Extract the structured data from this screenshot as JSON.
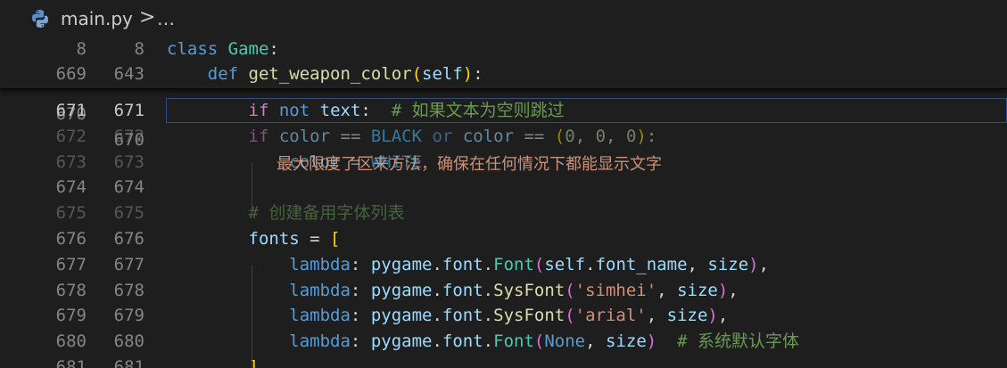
{
  "breadcrumb": {
    "file_name": "main.py",
    "chevron": ">",
    "ellipsis": "…",
    "file_icon": "python-icon"
  },
  "sticky": [
    {
      "ln_orig": "8",
      "ln_mod": "8",
      "tokens": [
        [
          "kw",
          "class"
        ],
        [
          "punc",
          " "
        ],
        [
          "cls",
          "Game"
        ],
        [
          "punc",
          ":"
        ]
      ]
    },
    {
      "ln_orig": "669",
      "ln_mod": "643",
      "tokens": [
        [
          "punc",
          "    "
        ],
        [
          "kw",
          "def"
        ],
        [
          "punc",
          " "
        ],
        [
          "fn",
          "get_weapon_color"
        ],
        [
          "brk1",
          "("
        ],
        [
          "var",
          "self"
        ],
        [
          "brk1",
          ")"
        ],
        [
          "punc",
          ":"
        ]
      ]
    }
  ],
  "behind_sticky": {
    "ln_orig": "668",
    "ln_mod": "670",
    "ln_orig_2": "670",
    "text": "最大限度了区来方法，确保在任何情况下都能显示文字"
  },
  "lines": [
    {
      "ln_orig": "671",
      "ln_mod": "671",
      "current": true,
      "dim": false,
      "tokens": [
        [
          "punc",
          "        "
        ],
        [
          "ctrl",
          "if"
        ],
        [
          "punc",
          " "
        ],
        [
          "kw",
          "not"
        ],
        [
          "punc",
          " "
        ],
        [
          "var",
          "text"
        ],
        [
          "punc",
          ":  "
        ],
        [
          "cmt",
          "# 如果文本为空则跳过"
        ]
      ]
    },
    {
      "ln_orig": "672",
      "ln_mod": "672",
      "current": false,
      "dim": true,
      "tokens": [
        [
          "punc",
          "        "
        ],
        [
          "ctrl",
          "if"
        ],
        [
          "punc",
          " "
        ],
        [
          "var",
          "color"
        ],
        [
          "punc",
          " == "
        ],
        [
          "const",
          "BLACK"
        ],
        [
          "punc",
          " "
        ],
        [
          "kw",
          "or"
        ],
        [
          "punc",
          " "
        ],
        [
          "var",
          "color"
        ],
        [
          "punc",
          " == "
        ],
        [
          "brk1",
          "("
        ],
        [
          "num",
          "0"
        ],
        [
          "punc",
          ", "
        ],
        [
          "num",
          "0"
        ],
        [
          "punc",
          ", "
        ],
        [
          "num",
          "0"
        ],
        [
          "brk1",
          ")"
        ],
        [
          "punc",
          ":"
        ]
      ]
    },
    {
      "ln_orig": "673",
      "ln_mod": "673",
      "current": false,
      "dim": true,
      "tokens": [
        [
          "punc",
          "            "
        ],
        [
          "var",
          "color"
        ],
        [
          "punc",
          " = "
        ],
        [
          "const",
          "WHITE"
        ]
      ]
    },
    {
      "ln_orig": "674",
      "ln_mod": "674",
      "current": false,
      "dim": false,
      "tokens": []
    },
    {
      "ln_orig": "675",
      "ln_mod": "675",
      "current": false,
      "dim": true,
      "tokens": [
        [
          "punc",
          "        "
        ],
        [
          "cmt",
          "# 创建备用字体列表"
        ]
      ]
    },
    {
      "ln_orig": "676",
      "ln_mod": "676",
      "current": false,
      "dim": false,
      "tokens": [
        [
          "punc",
          "        "
        ],
        [
          "var",
          "fonts"
        ],
        [
          "punc",
          " = "
        ],
        [
          "brk1",
          "["
        ]
      ]
    },
    {
      "ln_orig": "677",
      "ln_mod": "677",
      "current": false,
      "dim": false,
      "tokens": [
        [
          "punc",
          "            "
        ],
        [
          "kw",
          "lambda"
        ],
        [
          "punc",
          ": "
        ],
        [
          "var",
          "pygame"
        ],
        [
          "punc",
          "."
        ],
        [
          "var",
          "font"
        ],
        [
          "punc",
          "."
        ],
        [
          "cls",
          "Font"
        ],
        [
          "brk2",
          "("
        ],
        [
          "var",
          "self"
        ],
        [
          "punc",
          "."
        ],
        [
          "var",
          "font_name"
        ],
        [
          "punc",
          ", "
        ],
        [
          "var",
          "size"
        ],
        [
          "brk2",
          ")"
        ],
        [
          "punc",
          ","
        ]
      ]
    },
    {
      "ln_orig": "678",
      "ln_mod": "678",
      "current": false,
      "dim": false,
      "tokens": [
        [
          "punc",
          "            "
        ],
        [
          "kw",
          "lambda"
        ],
        [
          "punc",
          ": "
        ],
        [
          "var",
          "pygame"
        ],
        [
          "punc",
          "."
        ],
        [
          "var",
          "font"
        ],
        [
          "punc",
          "."
        ],
        [
          "fn",
          "SysFont"
        ],
        [
          "brk2",
          "("
        ],
        [
          "str",
          "'simhei'"
        ],
        [
          "punc",
          ", "
        ],
        [
          "var",
          "size"
        ],
        [
          "brk2",
          ")"
        ],
        [
          "punc",
          ","
        ]
      ]
    },
    {
      "ln_orig": "679",
      "ln_mod": "679",
      "current": false,
      "dim": false,
      "tokens": [
        [
          "punc",
          "            "
        ],
        [
          "kw",
          "lambda"
        ],
        [
          "punc",
          ": "
        ],
        [
          "var",
          "pygame"
        ],
        [
          "punc",
          "."
        ],
        [
          "var",
          "font"
        ],
        [
          "punc",
          "."
        ],
        [
          "fn",
          "SysFont"
        ],
        [
          "brk2",
          "("
        ],
        [
          "str",
          "'arial'"
        ],
        [
          "punc",
          ", "
        ],
        [
          "var",
          "size"
        ],
        [
          "brk2",
          ")"
        ],
        [
          "punc",
          ","
        ]
      ]
    },
    {
      "ln_orig": "680",
      "ln_mod": "680",
      "current": false,
      "dim": false,
      "tokens": [
        [
          "punc",
          "            "
        ],
        [
          "kw",
          "lambda"
        ],
        [
          "punc",
          ": "
        ],
        [
          "var",
          "pygame"
        ],
        [
          "punc",
          "."
        ],
        [
          "var",
          "font"
        ],
        [
          "punc",
          "."
        ],
        [
          "cls",
          "Font"
        ],
        [
          "brk2",
          "("
        ],
        [
          "kw",
          "None"
        ],
        [
          "punc",
          ", "
        ],
        [
          "var",
          "size"
        ],
        [
          "brk2",
          ")"
        ],
        [
          "punc",
          "  "
        ],
        [
          "cmt",
          "# 系统默认字体"
        ]
      ]
    },
    {
      "ln_orig": "681",
      "ln_mod": "681",
      "current": false,
      "dim": false,
      "tokens": [
        [
          "punc",
          "        "
        ],
        [
          "brk1",
          "]"
        ]
      ]
    }
  ]
}
